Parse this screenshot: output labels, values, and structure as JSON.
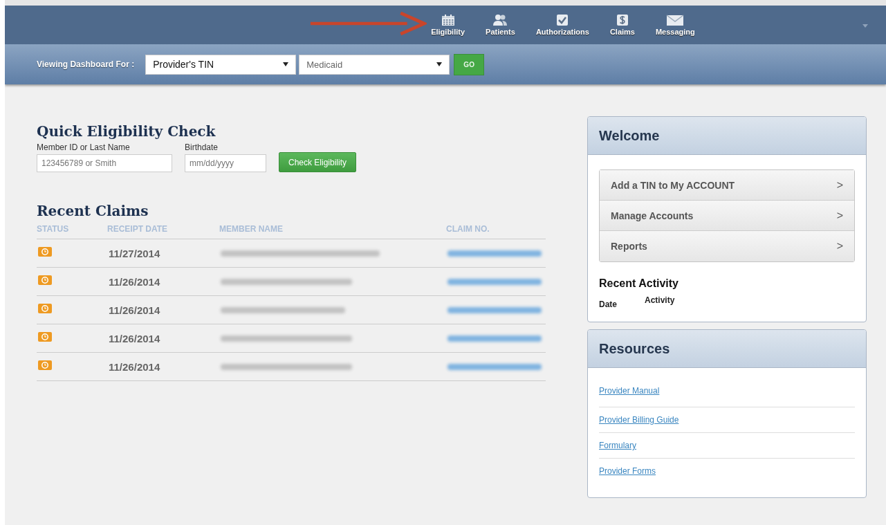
{
  "nav": {
    "items": [
      {
        "label": "Eligibility"
      },
      {
        "label": "Patients"
      },
      {
        "label": "Authorizations"
      },
      {
        "label": "Claims"
      },
      {
        "label": "Messaging"
      }
    ]
  },
  "toolbar": {
    "label": "Viewing Dashboard For :",
    "selects": [
      {
        "value": "Provider's TIN"
      },
      {
        "value": "Medicaid"
      }
    ],
    "button": "GO"
  },
  "quick_check": {
    "title": "Quick Eligibility Check",
    "fields": [
      {
        "label": "Member ID or Last Name",
        "placeholder": "123456789 or Smith"
      },
      {
        "label": "Birthdate",
        "placeholder": "mm/dd/yyyy"
      }
    ],
    "button": "Check Eligibility"
  },
  "recent_claims": {
    "title": "Recent Claims",
    "columns": [
      "STATUS",
      "RECEIPT DATE",
      "MEMBER NAME",
      "CLAIM NO."
    ],
    "rows": [
      {
        "receipt_date": "11/27/2014"
      },
      {
        "receipt_date": "11/26/2014"
      },
      {
        "receipt_date": "11/26/2014"
      },
      {
        "receipt_date": "11/26/2014"
      },
      {
        "receipt_date": "11/26/2014"
      }
    ]
  },
  "welcome": {
    "title": "Welcome",
    "menu": [
      "Add a TIN to My ACCOUNT",
      "Manage Accounts",
      "Reports"
    ],
    "chevron": ">",
    "activity_title": "Recent Activity",
    "activity_columns": [
      "Date",
      "Activity"
    ]
  },
  "resources": {
    "title": "Resources",
    "links": [
      "Provider Manual",
      "Provider Billing Guide",
      "Formulary",
      "Provider Forms"
    ]
  }
}
